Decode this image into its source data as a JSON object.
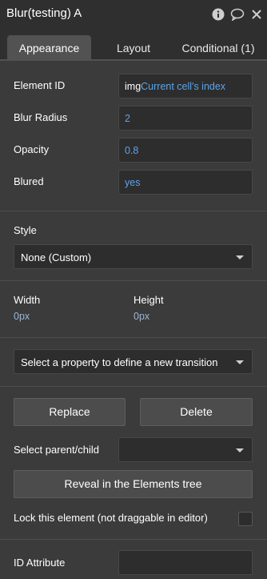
{
  "panel": {
    "title": "Blur(testing) A"
  },
  "tabs": [
    {
      "label": "Appearance"
    },
    {
      "label": "Layout"
    },
    {
      "label": "Conditional (1)"
    }
  ],
  "properties": {
    "element_id": {
      "label": "Element ID",
      "prefix": "img",
      "dynamic": "Current cell's index"
    },
    "blur_radius": {
      "label": "Blur Radius",
      "value": "2"
    },
    "opacity": {
      "label": "Opacity",
      "value": "0.8"
    },
    "blured": {
      "label": "Blured",
      "value": "yes"
    }
  },
  "style": {
    "label": "Style",
    "selected": "None (Custom)"
  },
  "size": {
    "width_label": "Width",
    "width_value": "0px",
    "height_label": "Height",
    "height_value": "0px"
  },
  "transition": {
    "placeholder": "Select a property to define a new transition"
  },
  "actions": {
    "replace_label": "Replace",
    "delete_label": "Delete",
    "select_parent_label": "Select parent/child",
    "reveal_label": "Reveal in the Elements tree",
    "lock_label": "Lock this element (not draggable in editor)",
    "id_attribute_label": "ID Attribute"
  }
}
